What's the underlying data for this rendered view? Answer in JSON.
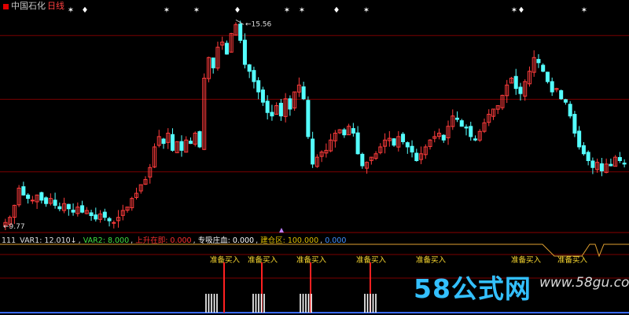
{
  "header": {
    "stock_name": "中国石化",
    "period": "日线"
  },
  "infobar": {
    "code": "111",
    "items": [
      {
        "text": "VAR1: 12.010↓",
        "color": "#e0e0e0"
      },
      {
        "text": "VAR2: 8.000",
        "color": "#40e040"
      },
      {
        "text": "上升在即: 0.000",
        "color": "#ff3030"
      },
      {
        "text": "专吸庄血: 0.000",
        "color": "#ffffff"
      },
      {
        "text": "建仓区: 100.000",
        "color": "#e0c000"
      },
      {
        "text": "0.000",
        "color": "#4090ff"
      }
    ]
  },
  "watermark": {
    "main": "58公式网",
    "url": "www.58gu.com"
  },
  "chart_data": [
    {
      "type": "candlestick",
      "annotations": {
        "high_label": "15.56",
        "low_label": "9.77"
      },
      "ylim": [
        9.6,
        16.0
      ],
      "closes": [
        9.8,
        9.95,
        10.3,
        10.8,
        10.6,
        10.5,
        10.45,
        10.6,
        10.45,
        10.35,
        10.5,
        10.3,
        10.2,
        10.35,
        10.2,
        10.1,
        10.25,
        10.1,
        10.15,
        10.0,
        9.9,
        10.05,
        9.95,
        9.85,
        9.8,
        9.95,
        10.15,
        10.25,
        10.5,
        10.65,
        10.9,
        11.05,
        11.4,
        12.0,
        12.3,
        12.1,
        12.4,
        11.9,
        12.15,
        11.9,
        12.2,
        12.1,
        12.4,
        12.0,
        14.0,
        14.6,
        14.3,
        14.9,
        15.05,
        14.7,
        15.3,
        15.56,
        15.1,
        14.4,
        14.2,
        13.9,
        13.6,
        13.3,
        13.0,
        12.9,
        13.2,
        12.9,
        13.4,
        13.1,
        13.6,
        13.8,
        13.4,
        12.3,
        11.5,
        11.7,
        11.85,
        11.9,
        12.2,
        12.4,
        12.5,
        12.35,
        12.6,
        12.4,
        11.8,
        11.45,
        11.55,
        11.7,
        11.8,
        12.0,
        12.2,
        12.25,
        12.05,
        12.3,
        12.15,
        12.0,
        11.85,
        11.6,
        11.8,
        12.0,
        12.2,
        12.3,
        12.4,
        12.2,
        12.6,
        12.9,
        12.8,
        12.6,
        12.55,
        12.3,
        12.2,
        12.45,
        12.7,
        12.95,
        13.1,
        13.2,
        13.5,
        13.8,
        14.0,
        13.7,
        13.55,
        13.9,
        14.2,
        14.6,
        14.45,
        14.2,
        13.9,
        13.6,
        13.7,
        13.4,
        13.3,
        12.9,
        12.4,
        12.0,
        11.8,
        11.6,
        11.4,
        11.55,
        11.3,
        11.5,
        11.45,
        11.7,
        11.6,
        11.5
      ]
    },
    {
      "type": "indicator",
      "level_line": 100.0,
      "signal_label": "准备买入",
      "signal_bars": 5
    }
  ]
}
